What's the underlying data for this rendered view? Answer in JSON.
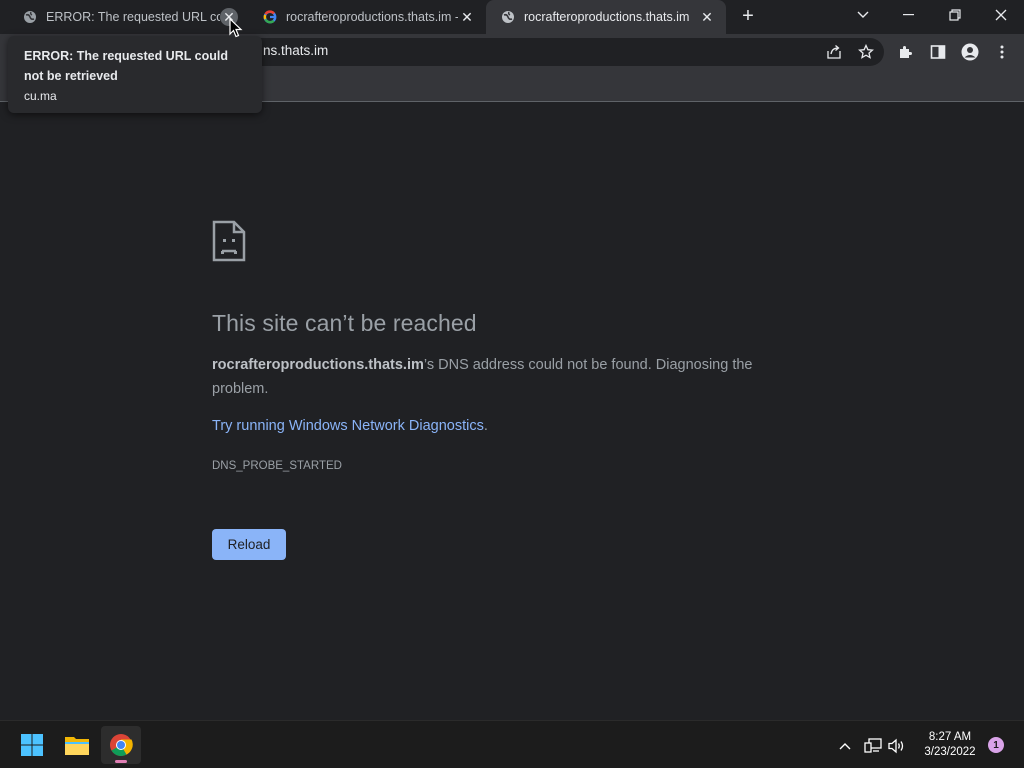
{
  "tabs": [
    {
      "title": "ERROR: The requested URL could not be retrieved",
      "favicon": "globe-icon"
    },
    {
      "title": "rocrafteroproductions.thats.im - Google Search",
      "favicon": "google-icon"
    },
    {
      "title": "rocrafteroproductions.thats.im",
      "favicon": "globe-icon"
    }
  ],
  "toolbar": {
    "url_visible": "ns.thats.im"
  },
  "tooltip": {
    "title": "ERROR: The requested URL could not be retrieved",
    "url": "cu.ma"
  },
  "page": {
    "heading": "This site can’t be reached",
    "host": "rocrafteroproductions.thats.im",
    "message": "’s DNS address could not be found. Diagnosing the problem.",
    "link_text": "Try running Windows Network Diagnostics",
    "link_suffix": ".",
    "error_code": "DNS_PROBE_STARTED",
    "reload_label": "Reload"
  },
  "taskbar": {
    "time": "8:27 AM",
    "date": "3/23/2022",
    "notification_count": "1"
  },
  "colors": {
    "accent": "#8ab4f8",
    "background": "#202124",
    "toolbar": "#35363a"
  }
}
